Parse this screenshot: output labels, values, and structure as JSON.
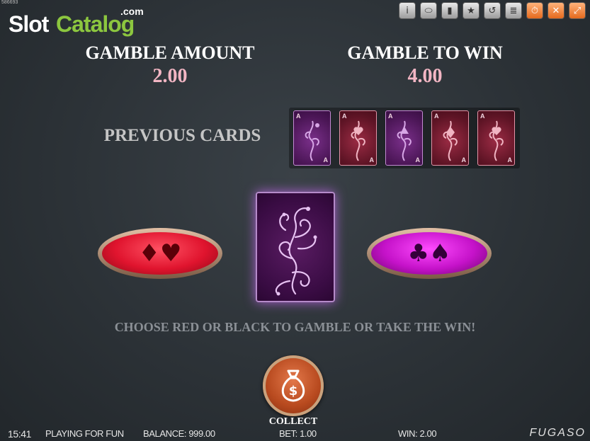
{
  "build_id": "586693",
  "logo": {
    "slot": "Slot",
    "catalog": "Catalog",
    "com": ".com"
  },
  "toolbar": [
    {
      "icon": "info-icon",
      "glyph": "i"
    },
    {
      "icon": "paylines-icon",
      "glyph": "⬭"
    },
    {
      "icon": "stats-icon",
      "glyph": "▮"
    },
    {
      "icon": "star-icon",
      "glyph": "★"
    },
    {
      "icon": "history-icon",
      "glyph": "↺"
    },
    {
      "icon": "paytable-icon",
      "glyph": "≣"
    },
    {
      "icon": "clock-icon",
      "glyph": "⏱"
    },
    {
      "icon": "sound-off-icon",
      "glyph": "✕"
    },
    {
      "icon": "fullscreen-icon",
      "glyph": "⤢"
    }
  ],
  "gamble": {
    "amount_label": "GAMBLE AMOUNT",
    "amount_value": "2.00",
    "win_label": "GAMBLE TO WIN",
    "win_value": "4.00"
  },
  "previous": {
    "label": "PREVIOUS CARDS",
    "cards": [
      {
        "rank": "A",
        "color": "purple"
      },
      {
        "rank": "A",
        "color": "red"
      },
      {
        "rank": "A",
        "color": "purple"
      },
      {
        "rank": "A",
        "color": "red"
      },
      {
        "rank": "A",
        "color": "red"
      }
    ]
  },
  "choices": {
    "red_suits": "♦♥",
    "black_suits": "♣♠"
  },
  "instruction": "CHOOSE RED OR BLACK TO GAMBLE OR TAKE THE WIN!",
  "collect_label": "COLLECT",
  "status": {
    "time": "15:41",
    "mode": "PLAYING FOR FUN",
    "balance": "BALANCE: 999.00",
    "bet": "BET: 1.00",
    "win": "WIN: 2.00"
  },
  "brand": "FUGASO",
  "colors": {
    "value_pink": "#f3b6c4",
    "red_button": "#e0142e",
    "magenta_button": "#c512c9",
    "card_back": "#3a0c44",
    "collect_orange": "#b84a1f"
  }
}
